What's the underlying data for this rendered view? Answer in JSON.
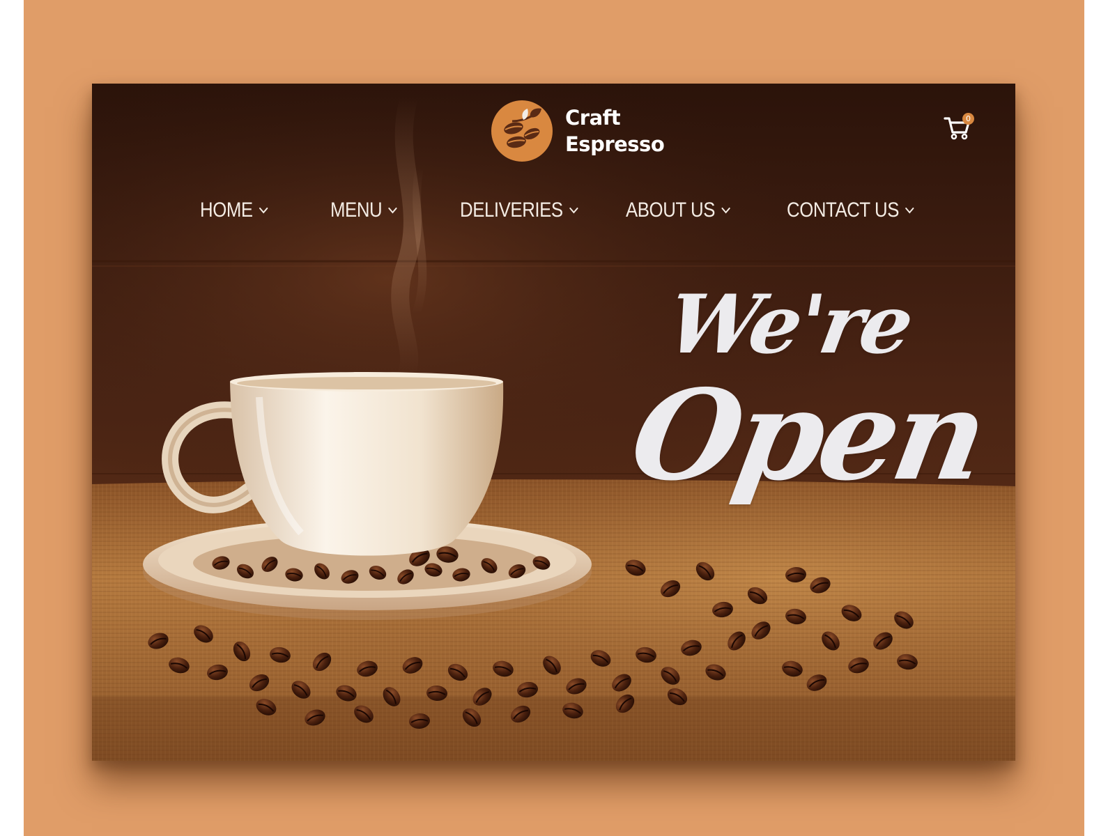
{
  "brand": {
    "line1": "Craft",
    "line2": "Espresso",
    "logo_icon": "coffee-beans-leaf-icon",
    "accent_color": "#d98840"
  },
  "cart": {
    "icon": "cart-icon",
    "count": "0"
  },
  "nav": {
    "items": [
      {
        "label": "HOME",
        "icon": "chevron-down-icon"
      },
      {
        "label": "MENU",
        "icon": "chevron-down-icon"
      },
      {
        "label": "DELIVERIES",
        "icon": "chevron-down-icon"
      },
      {
        "label": "ABOUT US",
        "icon": "chevron-down-icon"
      },
      {
        "label": "CONTACT US",
        "icon": "chevron-down-icon"
      }
    ]
  },
  "hero": {
    "headline_line1": "We're",
    "headline_line2": "Open",
    "image": "coffee-cup-with-beans-on-burlap"
  },
  "colors": {
    "page_background": "#e09d68",
    "headline": "#ecebee",
    "nav_text": "#f4ece4"
  }
}
